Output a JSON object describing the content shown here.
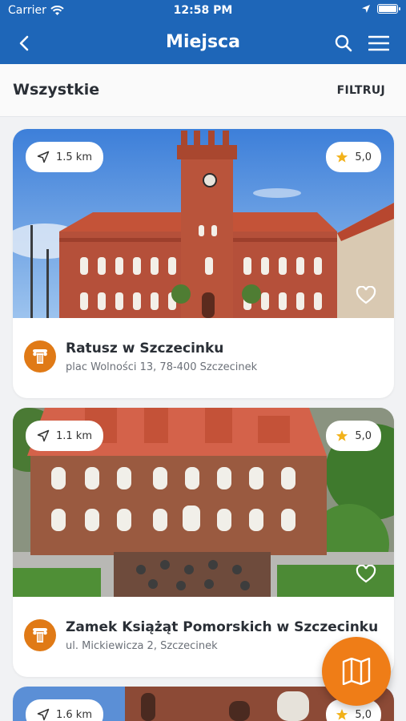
{
  "status_bar": {
    "carrier": "Carrier",
    "time": "12:58 PM"
  },
  "nav": {
    "title": "Miejsca"
  },
  "filter_bar": {
    "all_label": "Wszystkie",
    "filter_label": "FILTRUJ"
  },
  "places": [
    {
      "distance": "1.5 km",
      "rating": "5,0",
      "name": "Ratusz w Szczecinku",
      "address": "plac Wolności 13, 78-400 Szczecinek"
    },
    {
      "distance": "1.1 km",
      "rating": "5,0",
      "name": "Zamek Książąt Pomorskich w Szczecinku",
      "address": "ul. Mickiewicza 2,  Szczecinek"
    },
    {
      "distance": "1.6 km",
      "rating": "5,0"
    }
  ],
  "icons": {
    "back": "chevron-left-icon",
    "search": "search-icon",
    "menu": "hamburger-menu-icon",
    "distance": "location-arrow-icon",
    "rating": "star-icon",
    "favorite": "heart-icon",
    "category": "column-icon",
    "map": "map-icon"
  },
  "colors": {
    "nav_bg": "#1e66b8",
    "accent": "#e07a16",
    "star": "#f2b21b"
  }
}
